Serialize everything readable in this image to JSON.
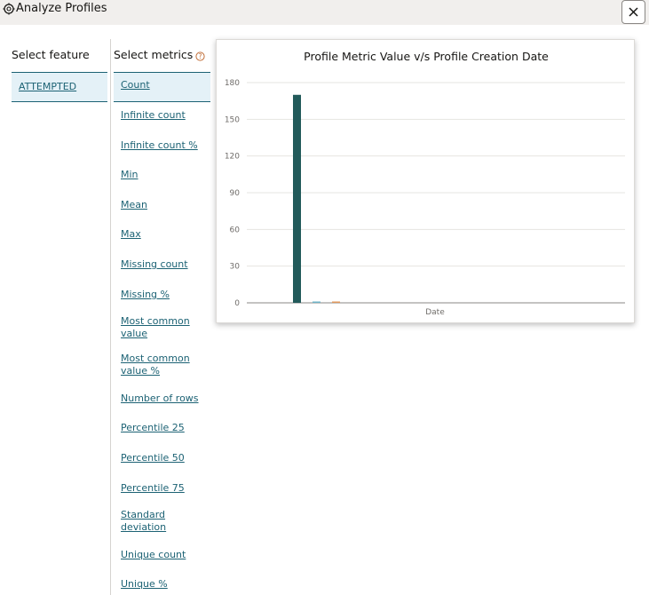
{
  "window": {
    "title": "Analyze Profiles"
  },
  "feature_panel": {
    "header": "Select feature",
    "items": [
      {
        "label": "ATTEMPTED",
        "selected": true
      }
    ]
  },
  "metrics_panel": {
    "header": "Select metrics",
    "items": [
      {
        "label": "Count",
        "selected": true
      },
      {
        "label": "Infinite count"
      },
      {
        "label": "Infinite count %"
      },
      {
        "label": "Min"
      },
      {
        "label": "Mean"
      },
      {
        "label": "Max"
      },
      {
        "label": "Missing count"
      },
      {
        "label": "Missing %"
      },
      {
        "label": "Most common value"
      },
      {
        "label": "Most common value %"
      },
      {
        "label": "Number of rows"
      },
      {
        "label": "Percentile 25"
      },
      {
        "label": "Percentile 50"
      },
      {
        "label": "Percentile 75"
      },
      {
        "label": "Standard deviation"
      },
      {
        "label": "Unique count"
      },
      {
        "label": "Unique %"
      }
    ]
  },
  "colors": {
    "accent": "#1c6274",
    "bar_main": "#225a5a",
    "bar_second": "#6fb3c7",
    "bar_third": "#e0995e"
  },
  "chart_data": {
    "type": "bar",
    "title": "Profile Metric Value v/s Profile Creation Date",
    "xlabel": "Date",
    "ylabel": "",
    "ylim": [
      0,
      180
    ],
    "yticks": [
      0,
      30,
      60,
      90,
      120,
      150,
      180
    ],
    "grid": true,
    "series": [
      {
        "color": "#225a5a",
        "values": [
          170
        ]
      },
      {
        "color": "#6fb3c7",
        "values": [
          1
        ]
      },
      {
        "color": "#e0995e",
        "values": [
          1
        ]
      }
    ]
  }
}
